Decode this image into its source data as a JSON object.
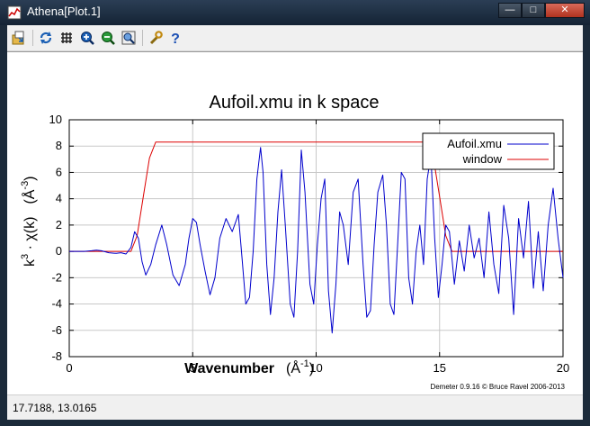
{
  "window": {
    "title": "Athena[Plot.1]",
    "minimize": "—",
    "maximize": "□",
    "close": "✕"
  },
  "toolbar": {
    "icons": [
      "export-icon",
      "refresh-icon",
      "grid-icon",
      "zoom-in-icon",
      "zoom-out-icon",
      "zoom-fit-icon",
      "settings-icon",
      "help-icon"
    ]
  },
  "status": {
    "cursor": "17.7188,  13.0165"
  },
  "colors": {
    "series1": "#0000cc",
    "series2": "#dd0000"
  },
  "chart_data": {
    "type": "line",
    "title": "Aufoil.xmu in k space",
    "xlabel": "Wavenumber",
    "xunit_base": "(Å",
    "xunit_exp": "-1",
    "ylabel_main": "k",
    "ylabel_exp": "3",
    "ylabel_rest": " · χ(k)",
    "yunit_base": "(Å",
    "yunit_exp": "-3",
    "xlim": [
      0,
      20
    ],
    "ylim": [
      -8,
      10
    ],
    "xticks": [
      0,
      5,
      10,
      15,
      20
    ],
    "yticks": [
      -8,
      -6,
      -4,
      -2,
      0,
      2,
      4,
      6,
      8,
      10
    ],
    "grid": true,
    "legend_position": "top-right",
    "footer": "Demeter 0.9.16 © Bruce Ravel 2006-2013",
    "series": [
      {
        "name": "Aufoil.xmu",
        "color": "#0000cc",
        "x": [
          0,
          0.6,
          0.9,
          1.1,
          1.3,
          1.6,
          1.9,
          2.1,
          2.3,
          2.5,
          2.65,
          2.8,
          2.95,
          3.1,
          3.3,
          3.5,
          3.75,
          3.95,
          4.2,
          4.45,
          4.7,
          4.85,
          5.0,
          5.15,
          5.3,
          5.5,
          5.7,
          5.9,
          6.1,
          6.35,
          6.6,
          6.85,
          7.0,
          7.15,
          7.3,
          7.45,
          7.6,
          7.75,
          7.85,
          8.0,
          8.15,
          8.3,
          8.45,
          8.6,
          8.75,
          8.95,
          9.1,
          9.25,
          9.4,
          9.55,
          9.75,
          9.9,
          10.05,
          10.2,
          10.35,
          10.5,
          10.65,
          10.8,
          10.95,
          11.1,
          11.3,
          11.5,
          11.7,
          11.9,
          12.05,
          12.2,
          12.35,
          12.5,
          12.7,
          12.85,
          13.0,
          13.15,
          13.3,
          13.45,
          13.6,
          13.75,
          13.9,
          14.05,
          14.2,
          14.35,
          14.5,
          14.65,
          14.8,
          14.95,
          15.1,
          15.25,
          15.4,
          15.6,
          15.8,
          16.0,
          16.2,
          16.4,
          16.6,
          16.8,
          17.0,
          17.2,
          17.4,
          17.6,
          17.8,
          18.0,
          18.2,
          18.4,
          18.6,
          18.8,
          19.0,
          19.2,
          19.4,
          19.6,
          19.8,
          20.0
        ],
        "y": [
          0,
          0,
          0.05,
          0.1,
          0.05,
          -0.1,
          -0.15,
          -0.1,
          -0.2,
          0.3,
          1.5,
          1.0,
          -0.8,
          -1.8,
          -1.0,
          0.5,
          2.0,
          0.5,
          -1.8,
          -2.6,
          -1.0,
          1.0,
          2.5,
          2.2,
          0.5,
          -1.5,
          -3.3,
          -2.0,
          1.0,
          2.5,
          1.5,
          2.8,
          -0.5,
          -4.0,
          -3.5,
          0.0,
          5.5,
          7.9,
          6.0,
          -1.0,
          -4.8,
          -2.0,
          3.0,
          6.2,
          2.0,
          -4.0,
          -5.0,
          0.0,
          7.7,
          4.5,
          -2.5,
          -4.0,
          0.5,
          4.0,
          5.5,
          -3.0,
          -6.2,
          -2.5,
          3.0,
          2.0,
          -1.0,
          4.5,
          5.5,
          -1.0,
          -5.0,
          -4.5,
          0.5,
          4.5,
          5.8,
          2.0,
          -4.0,
          -4.8,
          0.5,
          6.0,
          5.5,
          -2.0,
          -4.0,
          0.0,
          2.0,
          -1.0,
          5.5,
          7.3,
          1.0,
          -3.5,
          -1.0,
          2.0,
          1.5,
          -2.5,
          0.8,
          -1.5,
          2.0,
          -0.5,
          1.0,
          -2.0,
          3.0,
          -1.0,
          -3.2,
          3.5,
          1.0,
          -4.8,
          2.5,
          -0.5,
          3.8,
          -2.8,
          1.5,
          -3.0,
          2.0,
          4.8,
          1.0,
          -2.0
        ]
      },
      {
        "name": "window",
        "color": "#dd0000",
        "x": [
          0,
          2.5,
          2.75,
          3.0,
          3.25,
          3.5,
          14.5,
          14.75,
          15.0,
          15.25,
          15.5,
          20
        ],
        "y": [
          0,
          0,
          1.2,
          4.15,
          7.1,
          8.3,
          8.3,
          7.1,
          4.15,
          1.2,
          0,
          0
        ]
      }
    ]
  }
}
